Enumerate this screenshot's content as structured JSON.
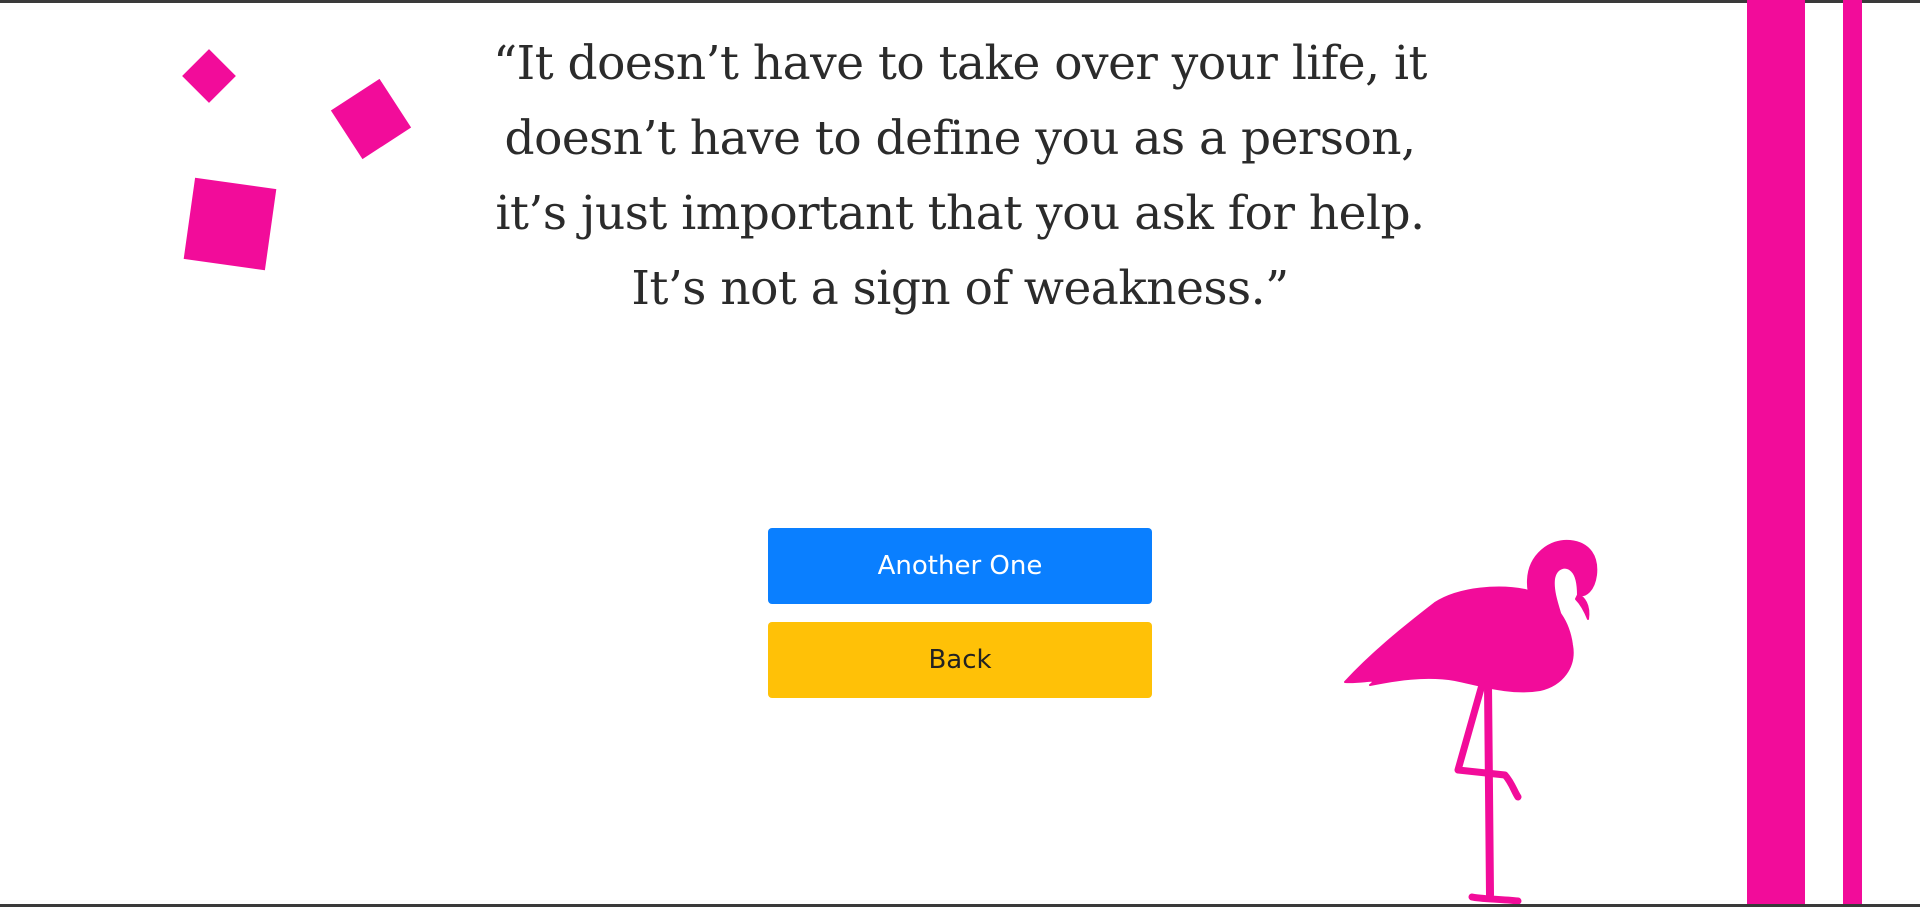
{
  "quote": {
    "text": "“It doesn’t have to take over your life, it doesn’t have to define you as a person, it’s just important that you ask for help. It’s not a sign of weakness.”"
  },
  "buttons": {
    "another_label": "Another One",
    "back_label": "Back"
  },
  "decorations": {
    "accent_color": "#f20c9a",
    "primary_button_color": "#0a7fff",
    "secondary_button_color": "#ffc107",
    "illustration": "flamingo-icon"
  }
}
